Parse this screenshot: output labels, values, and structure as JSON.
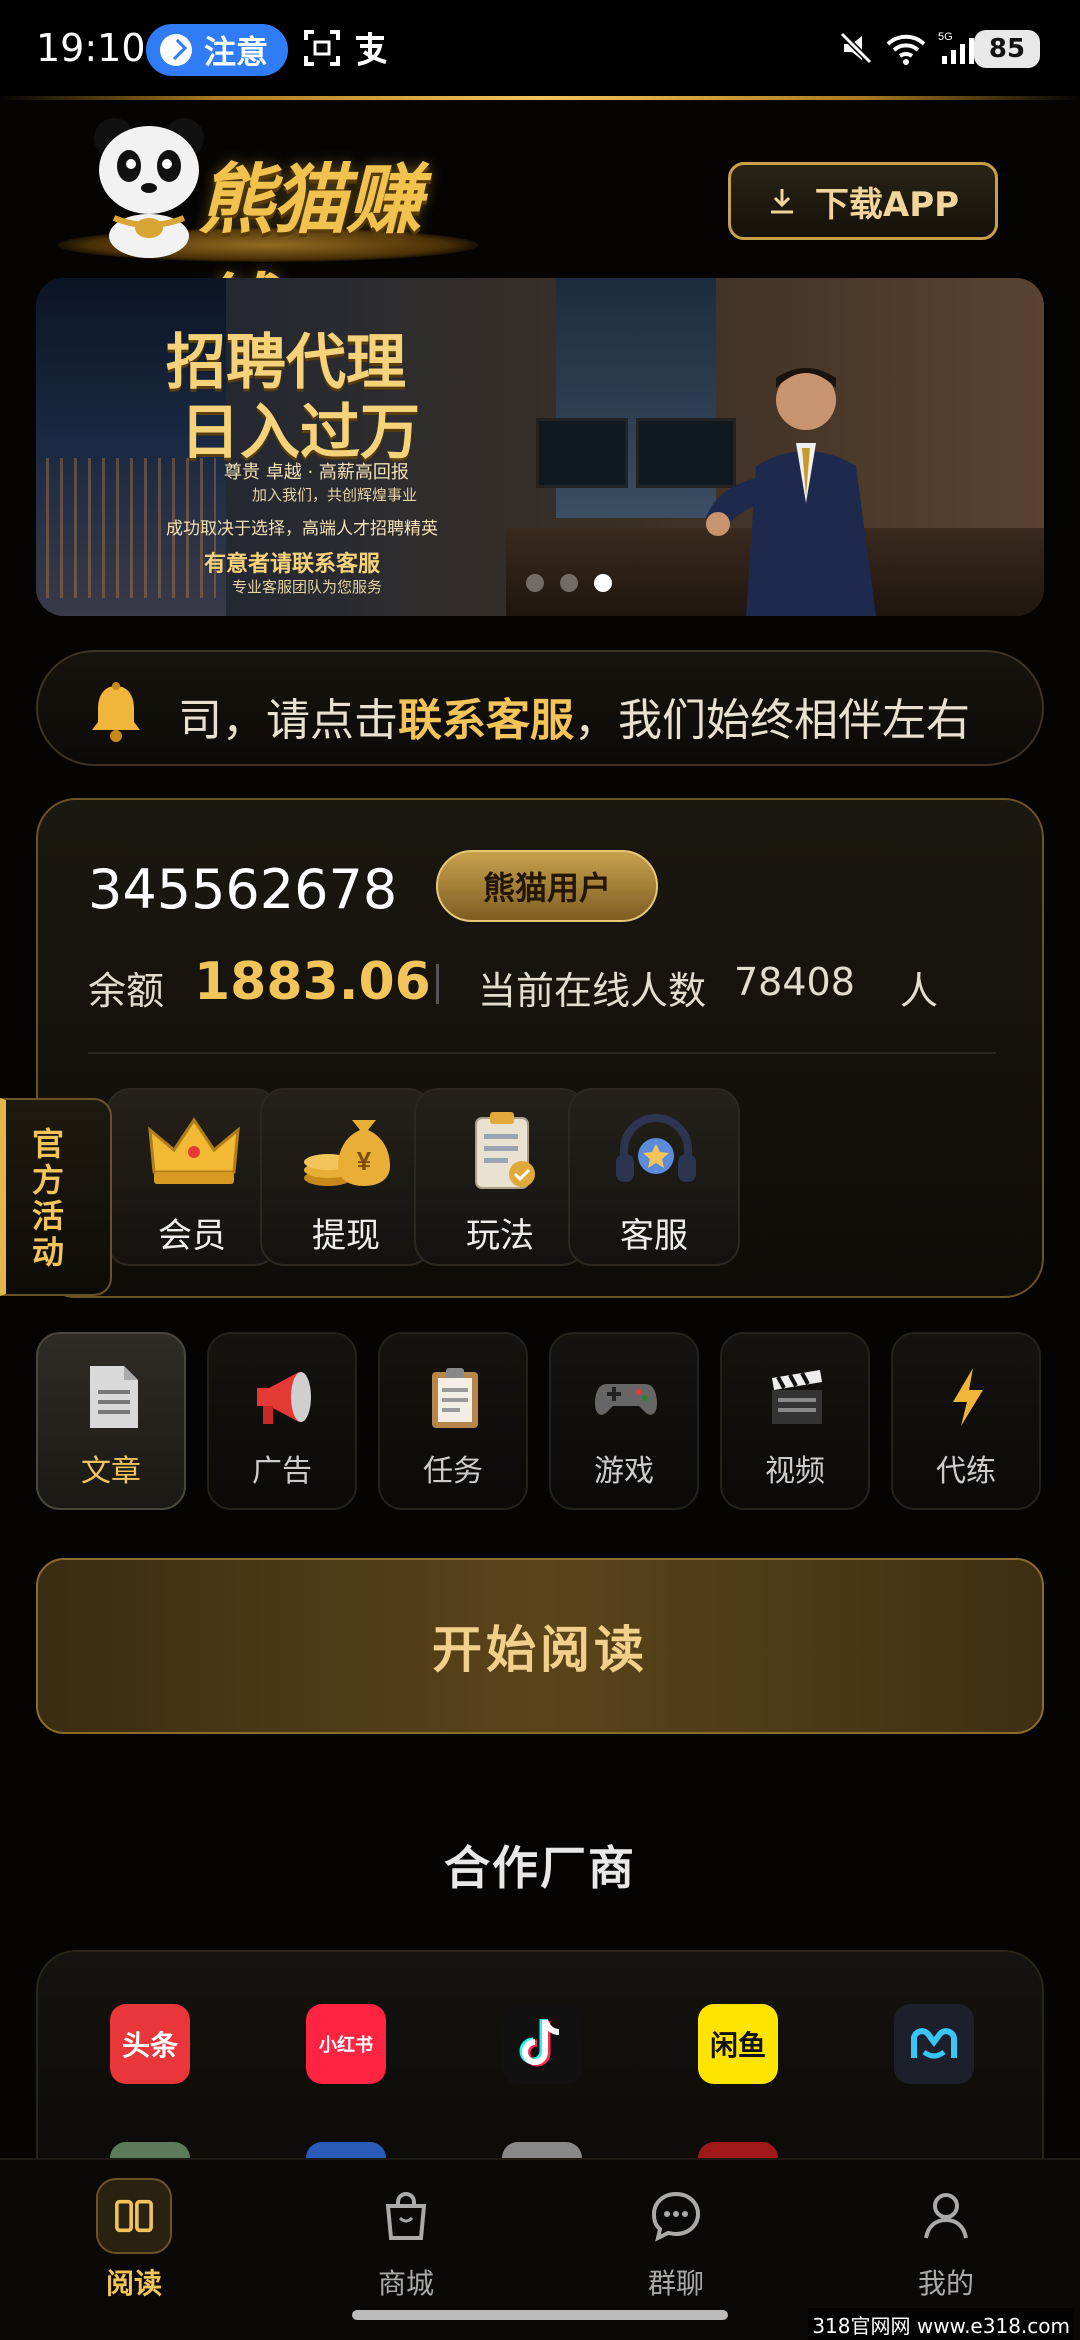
{
  "status_bar": {
    "time": "19:10",
    "pill_label": "注意",
    "battery": "85",
    "net_label": "5G"
  },
  "header": {
    "logo_text": "熊猫赚钱",
    "download_label": "下载APP"
  },
  "banner": {
    "title_line1": "招聘代理",
    "title_line2": "日入过万",
    "sub1": "尊贵 卓越 · 高薪高回报",
    "sub2": "加入我们，共创辉煌事业",
    "sub3": "成功取决于选择，高端人才招聘精英",
    "sub4": "有意者请联系客服",
    "sub5": "专业客服团队为您服务",
    "slides": 3,
    "active_slide": 3
  },
  "notice": {
    "text_before": "司，请点击",
    "highlight": "联系客服",
    "text_after": "，我们始终相伴左右"
  },
  "account": {
    "user_id": "345562678",
    "user_tag": "熊猫用户",
    "balance_label": "余额",
    "balance_value": "1883.06",
    "online_label": "当前在线人数",
    "online_count": "78408",
    "online_unit": "人"
  },
  "quick_actions": [
    {
      "label": "会员",
      "icon": "crown-icon"
    },
    {
      "label": "提现",
      "icon": "money-bag-icon"
    },
    {
      "label": "玩法",
      "icon": "clipboard-icon"
    },
    {
      "label": "客服",
      "icon": "headset-icon"
    }
  ],
  "side_tab": {
    "label": "官方活动"
  },
  "categories": [
    {
      "label": "文章",
      "icon": "document-icon",
      "active": true
    },
    {
      "label": "广告",
      "icon": "megaphone-icon",
      "active": false
    },
    {
      "label": "任务",
      "icon": "task-clipboard-icon",
      "active": false
    },
    {
      "label": "游戏",
      "icon": "gamepad-icon",
      "active": false
    },
    {
      "label": "视频",
      "icon": "clapperboard-icon",
      "active": false
    },
    {
      "label": "代练",
      "icon": "lightning-icon",
      "active": false
    }
  ],
  "start_button": {
    "label": "开始阅读"
  },
  "partners": {
    "title": "合作厂商",
    "items": [
      {
        "name": "头条",
        "bg": "#e8363a",
        "fg": "#fff"
      },
      {
        "name": "小红书",
        "bg": "#ff2442",
        "fg": "#fff"
      },
      {
        "name": "抖音",
        "bg": "#111111",
        "fg": "#fff"
      },
      {
        "name": "闲鱼",
        "bg": "#ffe400",
        "fg": "#111"
      },
      {
        "name": "M",
        "bg": "#1d1f2a",
        "fg": "#39c5f5"
      }
    ]
  },
  "bottom_nav": [
    {
      "label": "阅读",
      "icon": "book-icon",
      "active": true
    },
    {
      "label": "商城",
      "icon": "shopping-bag-icon",
      "active": false
    },
    {
      "label": "群聊",
      "icon": "chat-icon",
      "active": false
    },
    {
      "label": "我的",
      "icon": "person-icon",
      "active": false
    }
  ],
  "watermark": "318官网网 www.e318.com",
  "colors": {
    "gold": "#f3c45a",
    "background": "#050403"
  }
}
